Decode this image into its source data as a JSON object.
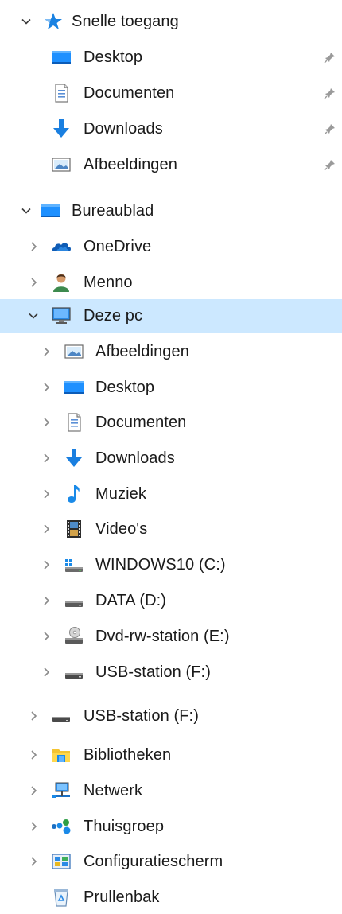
{
  "quick_access": {
    "label": "Snelle toegang",
    "icon": "star-icon",
    "items": [
      {
        "label": "Desktop",
        "icon": "desktop-icon"
      },
      {
        "label": "Documenten",
        "icon": "document-icon"
      },
      {
        "label": "Downloads",
        "icon": "download-icon"
      },
      {
        "label": "Afbeeldingen",
        "icon": "pictures-icon"
      }
    ]
  },
  "desktop_root": {
    "label": "Bureaublad",
    "icon": "desktop-icon",
    "items": [
      {
        "label": "OneDrive",
        "icon": "onedrive-icon"
      },
      {
        "label": "Menno",
        "icon": "user-icon"
      }
    ]
  },
  "this_pc": {
    "label": "Deze pc",
    "icon": "computer-icon",
    "items": [
      {
        "label": "Afbeeldingen",
        "icon": "pictures-icon"
      },
      {
        "label": "Desktop",
        "icon": "desktop-icon"
      },
      {
        "label": "Documenten",
        "icon": "document-icon"
      },
      {
        "label": "Downloads",
        "icon": "download-icon"
      },
      {
        "label": "Muziek",
        "icon": "music-icon"
      },
      {
        "label": "Video's",
        "icon": "video-icon"
      },
      {
        "label": "WINDOWS10 (C:)",
        "icon": "windows-drive-icon"
      },
      {
        "label": "DATA (D:)",
        "icon": "drive-icon"
      },
      {
        "label": "Dvd-rw-station (E:)",
        "icon": "dvd-drive-icon"
      },
      {
        "label": "USB-station (F:)",
        "icon": "usb-drive-icon"
      }
    ]
  },
  "root_items": [
    {
      "label": "USB-station (F:)",
      "icon": "usb-drive-icon"
    },
    {
      "label": "Bibliotheken",
      "icon": "libraries-icon"
    },
    {
      "label": "Netwerk",
      "icon": "network-icon"
    },
    {
      "label": "Thuisgroep",
      "icon": "homegroup-icon"
    },
    {
      "label": "Configuratiescherm",
      "icon": "control-panel-icon"
    },
    {
      "label": "Prullenbak",
      "icon": "recycle-bin-icon"
    }
  ],
  "colors": {
    "selected_background": "#cce8ff",
    "accent_blue": "#0078d7"
  }
}
